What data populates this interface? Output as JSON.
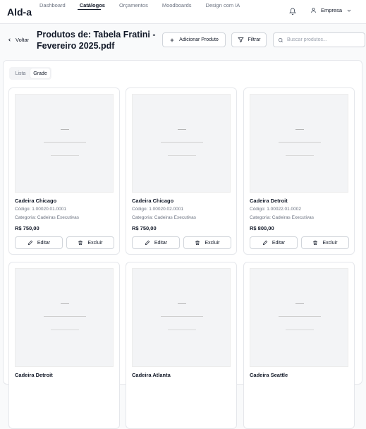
{
  "app": {
    "logo": "Ald-a"
  },
  "nav": {
    "items": [
      "Dashboard",
      "Catálogos",
      "Orçamentos",
      "Moodboards",
      "Design com IA"
    ],
    "active_index": 1
  },
  "user": {
    "label": "Empresa"
  },
  "header": {
    "back_label": "Voltar",
    "title_line1": "Produtos de: Tabela Fratini -",
    "title_line2": "Fevereiro 2025.pdf",
    "add_button": "Adicionar Produto",
    "filter_button": "Filtrar",
    "search_placeholder": "Buscar produtos..."
  },
  "view_toggle": {
    "list": "Lista",
    "grid": "Grade",
    "active": "grid"
  },
  "products": [
    {
      "name": "Cadeira Chicago",
      "code": "Código: 1.00020.01.0001",
      "category": "Categoria: Cadeiras Executivas",
      "price": "R$ 750,00"
    },
    {
      "name": "Cadeira Chicago",
      "code": "Código: 1.00020.02.0001",
      "category": "Categoria: Cadeiras Executivas",
      "price": "R$ 750,00"
    },
    {
      "name": "Cadeira Detroit",
      "code": "Código: 1.00022.01.0002",
      "category": "Categoria: Cadeiras Executivas",
      "price": "R$ 800,00"
    },
    {
      "name": "Cadeira Detroit",
      "code": "",
      "category": "",
      "price": ""
    },
    {
      "name": "Cadeira Atlanta",
      "code": "",
      "category": "",
      "price": ""
    },
    {
      "name": "Cadeira Seattle",
      "code": "",
      "category": "",
      "price": ""
    }
  ],
  "card_actions": {
    "edit": "Editar",
    "delete": "Excluir"
  },
  "colors": {
    "border": "#e5e7eb",
    "text": "#111827",
    "muted": "#6b7280"
  }
}
